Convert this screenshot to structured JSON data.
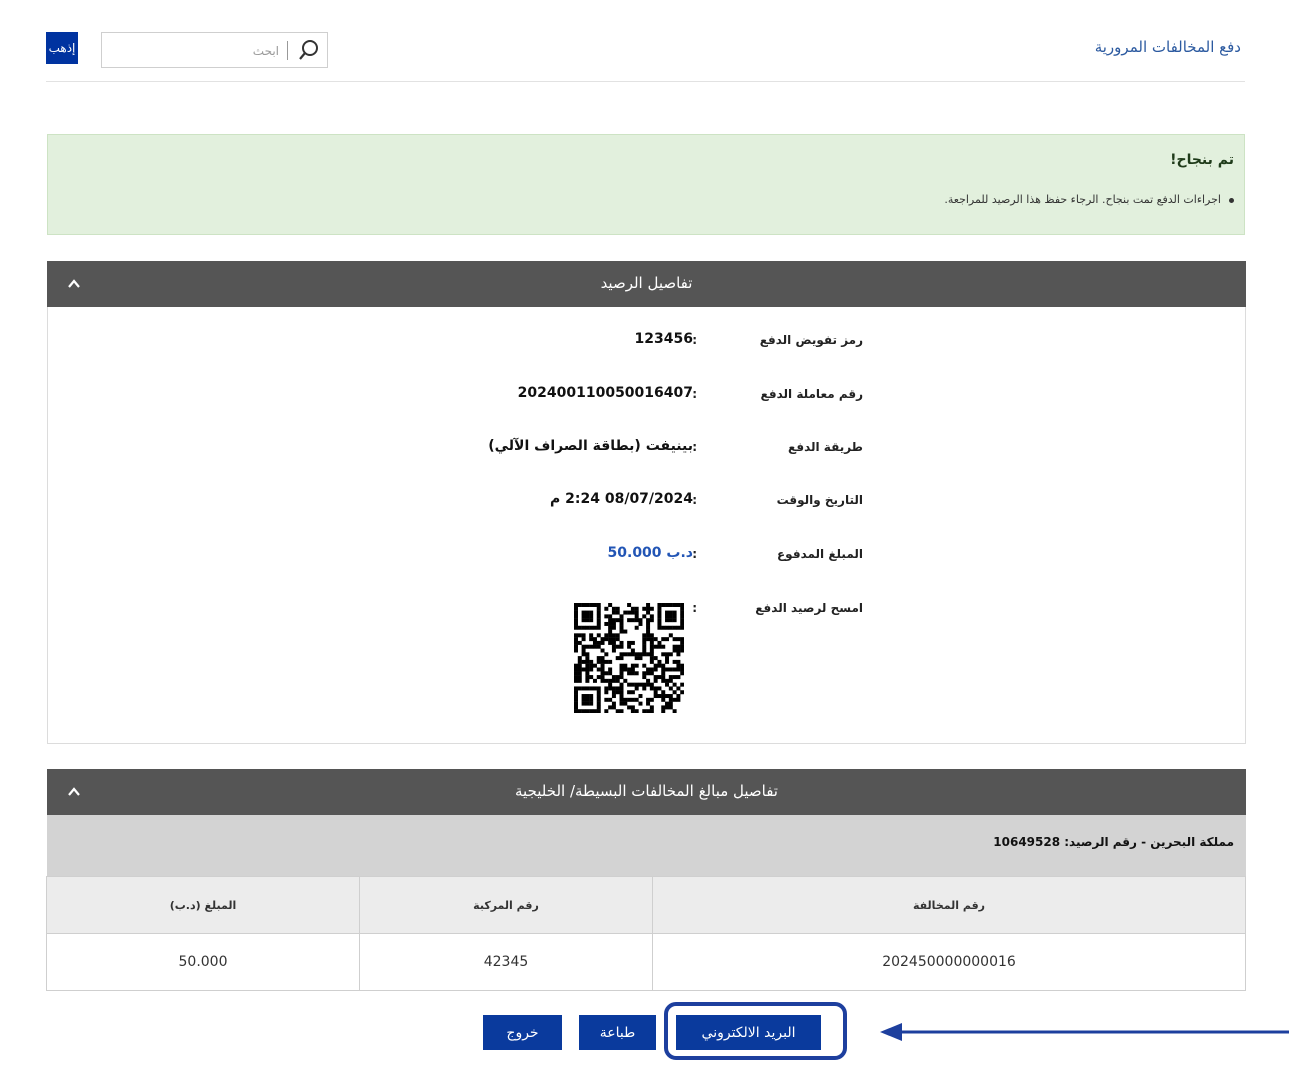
{
  "header": {
    "page_title": "دفع المخالفات المرورية",
    "search_placeholder": "ابحث",
    "go_label": "إذهب"
  },
  "success": {
    "title": "تم بنجاح!",
    "message": "اجراءات الدفع تمت بنجاح. الرجاء حفظ هذا الرصيد للمراجعة."
  },
  "receipt": {
    "title": "تفاصيل الرصيد",
    "rows": [
      {
        "label": "رمز تفويض الدفع",
        "value": "123456"
      },
      {
        "label": "رقم معاملة الدفع",
        "value": "202400110050016407"
      },
      {
        "label": "طريقة الدفع",
        "value": "بينيفت (بطاقة الصراف الآلي)"
      },
      {
        "label": "التاريخ والوقت",
        "value": "08/07/2024 2:24 م"
      },
      {
        "label": "المبلغ المدفوع",
        "value": "د.ب 50.000"
      },
      {
        "label": "امسح لرصيد الدفع",
        "value": ""
      }
    ],
    "colon": ":"
  },
  "violations": {
    "title": "تفاصيل مبالغ المخالفات البسيطة/ الخليجية",
    "receipt_ref": "مملكة البحرين - رقم الرصيد: 10649528",
    "columns": [
      "رقم المخالفة",
      "رقم المركبة",
      "المبلغ (د.ب)"
    ],
    "rows": [
      [
        "202450000000016",
        "42345",
        "50.000"
      ]
    ]
  },
  "actions": {
    "email": "البريد الالكتروني",
    "print": "طباعة",
    "exit": "خروج"
  },
  "colors": {
    "primary": "#0a3a9d",
    "panel_header": "#555555",
    "success_bg": "#e2f0dd",
    "link": "#2c5aa0"
  },
  "icons": [
    "search-icon",
    "chevron-up-icon",
    "qr-code",
    "arrow-left-icon"
  ]
}
